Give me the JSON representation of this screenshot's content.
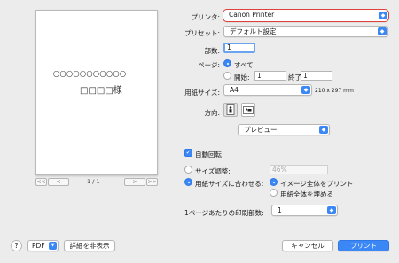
{
  "preview": {
    "address_line": "〇〇〇〇〇〇〇〇〇〇〇",
    "name_line": "□□□□様",
    "pager": {
      "first": "<<",
      "prev": "<",
      "page_text": "1 / 1",
      "next": ">",
      "last": ">>"
    }
  },
  "printer": {
    "label": "プリンタ:",
    "value": "Canon Printer"
  },
  "preset": {
    "label": "プリセット:",
    "value": "デフォルト設定"
  },
  "copies": {
    "label": "部数:",
    "value": "1"
  },
  "pages": {
    "label": "ページ:",
    "all_label": "すべて",
    "from_label": "開始:",
    "from_value": "1",
    "to_label": "終了:",
    "to_value": "1"
  },
  "paper_size": {
    "label": "用紙サイズ:",
    "value": "A4",
    "dimensions": "210 x 297 mm"
  },
  "orientation": {
    "label": "方向:"
  },
  "section_popup": {
    "value": "プレビュー"
  },
  "auto_rotate": {
    "label": "自動回転"
  },
  "scale": {
    "label": "サイズ調整:",
    "value": "46%"
  },
  "fit": {
    "label": "用紙サイズに合わせる:",
    "option_print_entire": "イメージ全体をプリント",
    "option_fill_paper": "用紙全体を埋める"
  },
  "copies_per_page": {
    "label": "1ページあたりの印刷部数:",
    "value": "1"
  },
  "footer": {
    "help": "?",
    "pdf_label": "PDF",
    "hide_details": "詳細を非表示",
    "cancel": "キャンセル",
    "print": "プリント"
  }
}
